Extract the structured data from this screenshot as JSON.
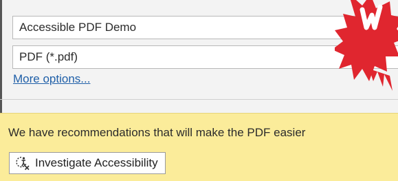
{
  "save_dialog": {
    "filename_value": "Accessible PDF Demo",
    "filetype_value": "PDF (*.pdf)",
    "more_options_label": "More options..."
  },
  "accessibility_banner": {
    "message": "We have recommendations that will make the PDF easier",
    "button_label": "Investigate Accessibility",
    "button_icon": "accessibility-check-icon",
    "background_color": "#fbec9a"
  },
  "badge": {
    "color": "#e0262f",
    "icon": "starburst-badge"
  }
}
